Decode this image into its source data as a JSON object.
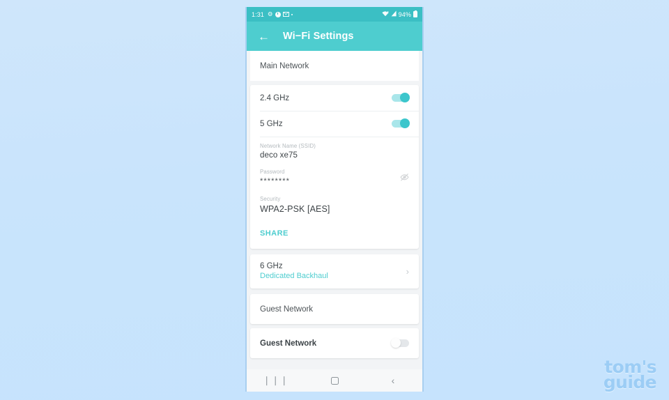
{
  "status_bar": {
    "time": "1:31",
    "battery_percent": "94%",
    "icons_left": [
      "gear-icon",
      "clock-dot-icon",
      "mail-icon",
      "dot-icon"
    ],
    "icons_right": [
      "wifi-icon",
      "signal-icon",
      "battery-icon"
    ],
    "background_color": "#3bbfc4"
  },
  "app_bar": {
    "back_label": "←",
    "title": "Wi−Fi Settings",
    "background_color": "#4ecdcf"
  },
  "main_network": {
    "section_title": "Main Network",
    "bands": [
      {
        "label": "2.4 GHz",
        "enabled": "on"
      },
      {
        "label": "5 GHz",
        "enabled": "on"
      }
    ],
    "ssid": {
      "label": "Network Name (SSID)",
      "value": "deco xe75"
    },
    "password": {
      "label": "Password",
      "value": "********",
      "toggle_icon": "eye-off-icon"
    },
    "security": {
      "label": "Security",
      "value": "WPA2-PSK [AES]"
    },
    "share_label": "SHARE"
  },
  "band_6ghz": {
    "title": "6 GHz",
    "subtitle": "Dedicated Backhaul",
    "chevron": "›",
    "accent_color": "#4ecdcf"
  },
  "guest_network": {
    "section_title": "Guest Network",
    "row_label": "Guest Network",
    "enabled": "off"
  },
  "nav_bar": {
    "recents": "❘❘❘",
    "home": "home-icon",
    "back": "‹"
  },
  "watermark": {
    "line1": "tom's",
    "line2": "guide",
    "color": "#9ccdf5"
  }
}
